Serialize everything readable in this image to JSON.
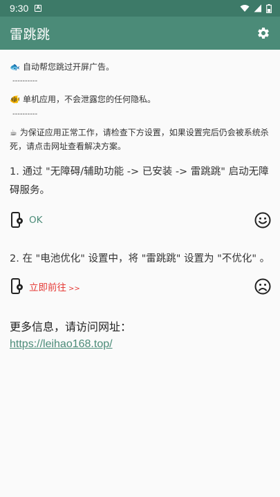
{
  "status_bar": {
    "time": "9:30",
    "notif_glyph": "A"
  },
  "app_bar": {
    "title": "雷跳跳"
  },
  "info": {
    "line1": {
      "emoji": "🐟",
      "text": "自动帮您跳过开屏广告。"
    },
    "sep1": "----------",
    "line2": {
      "emoji": "🐠",
      "text": "单机应用，不会泄露您的任何隐私。"
    },
    "sep2": "----------",
    "line3": {
      "emoji": "☕",
      "text": "为保证应用正常工作，请检查下方设置，如果设置完后仍会被系统杀死，请点击网址查看解决方案。"
    }
  },
  "step1": {
    "text": "1. 通过 \"无障碍/辅助功能 -> 已安装 -> 雷跳跳\" 启动无障碍服务。",
    "status": "OK",
    "face": "smile-icon"
  },
  "step2": {
    "text": "2. 在 \"电池优化\" 设置中，将 \"雷跳跳\" 设置为 \"不优化\" 。",
    "status": "立即前往",
    "arrow": ">>",
    "face": "frown-icon"
  },
  "more": {
    "label": "更多信息，请访问网址：",
    "url": "https://leihao168.top/"
  },
  "colors": {
    "primary": "#4b8b78",
    "status_bar": "#3d7a68",
    "warning": "#e53935"
  }
}
